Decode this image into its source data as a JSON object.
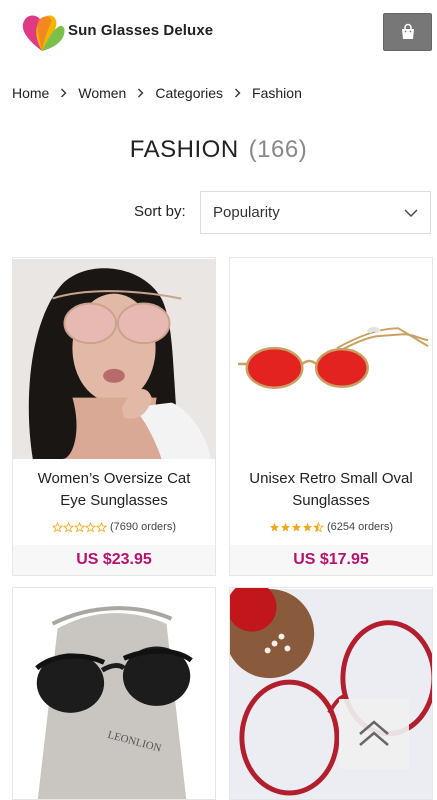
{
  "brand": {
    "name": "Sun Glasses Deluxe"
  },
  "header": {
    "cart_icon": "shopping-bag-icon"
  },
  "breadcrumb": {
    "items": [
      "Home",
      "Women",
      "Categories",
      "Fashion"
    ]
  },
  "page": {
    "title": "FASHION",
    "count": "(166)"
  },
  "sort": {
    "label": "Sort by:",
    "value": "Popularity"
  },
  "products": [
    {
      "name_line1": "Women’s Oversize Cat",
      "name_line2": "Eye Sunglasses",
      "rating": 0,
      "orders": "(7690 orders)",
      "price": "US $23.95"
    },
    {
      "name_line1": "Unisex Retro Small Oval",
      "name_line2": "Sunglasses",
      "rating": 4.5,
      "orders": "(6254 orders)",
      "price": "US $17.95"
    },
    {
      "name_line1": "",
      "name_line2": "",
      "rating": null,
      "orders": "",
      "price": ""
    },
    {
      "name_line1": "",
      "name_line2": "",
      "rating": null,
      "orders": "",
      "price": ""
    }
  ],
  "colors": {
    "price": "#b5126f",
    "star": "#f0a81c",
    "cart_bg": "#777777"
  },
  "back_to_top": {
    "icon": "chevron-up-double-icon"
  }
}
